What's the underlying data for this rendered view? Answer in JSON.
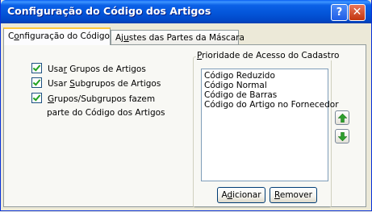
{
  "window": {
    "title": "Configuração do Código dos Artigos",
    "help_glyph": "?",
    "close_glyph": "✕"
  },
  "tabs": [
    {
      "label_pre": "C",
      "label_ul": "o",
      "label_post": "nfiguração do Código",
      "selected": true
    },
    {
      "label_pre": "Aj",
      "label_ul": "u",
      "label_post": "stes das Partes da Máscara",
      "selected": false
    }
  ],
  "checkboxes": [
    {
      "label_pre": "Usa",
      "label_ul": "r",
      "label_post": " Grupos de Artigos",
      "checked": true
    },
    {
      "label_pre": "Usar ",
      "label_ul": "S",
      "label_post": "ubgrupos de Artigos",
      "checked": true
    },
    {
      "label_pre": "",
      "label_ul": "G",
      "label_post": "rupos/Subgrupos fazem",
      "checked": true,
      "label_line2": "parte do Código dos Artigos"
    }
  ],
  "priority_group": {
    "label_pre": "",
    "label_ul": "P",
    "label_post": "rioridade de Acesso do Cadastro",
    "items": [
      "Código Reduzido",
      "Código Normal",
      "Código de Barras",
      "Código do Artigo no Fornecedor"
    ]
  },
  "buttons": {
    "add": {
      "label_pre": "A",
      "label_ul": "d",
      "label_post": "icionar"
    },
    "remove": {
      "label_pre": "",
      "label_ul": "R",
      "label_post": "emover"
    }
  },
  "colors": {
    "titlebar": "#0054E3",
    "arrow_green": "#2E9E2E",
    "checkmark_green": "#21A121"
  }
}
